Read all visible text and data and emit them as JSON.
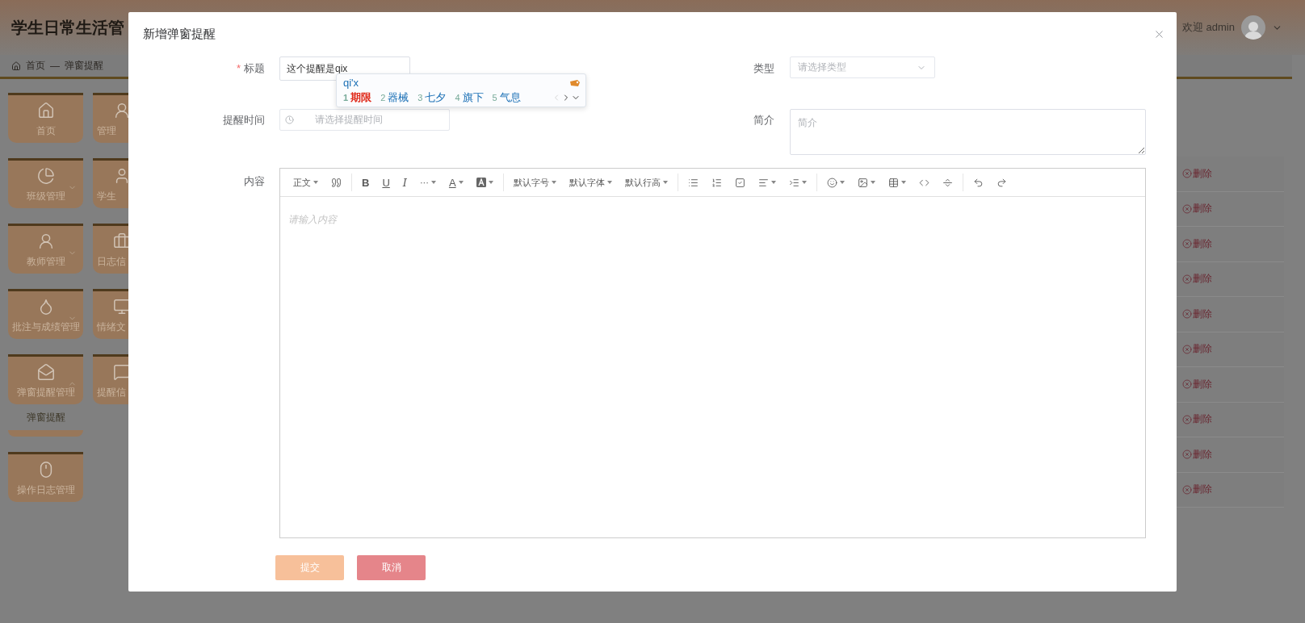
{
  "header": {
    "title": "学生日常生活管",
    "greeting": "欢迎 admin"
  },
  "breadcrumb": {
    "items": [
      "首页",
      "弹窗提醒"
    ],
    "separator": "—"
  },
  "sidebar": {
    "columns": [
      [
        {
          "label": "首页",
          "kind": "link"
        },
        {
          "label": "班级管理",
          "kind": "menu",
          "expanded": false
        },
        {
          "label": "教师管理",
          "kind": "menu",
          "expanded": false
        },
        {
          "label": "批注与成绩管理",
          "kind": "menu",
          "expanded": false
        },
        {
          "label": "弹窗提醒管理",
          "kind": "menu",
          "expanded": true,
          "children": [
            {
              "label": "弹窗提醒"
            }
          ]
        },
        {
          "label": "操作日志管理",
          "kind": "link"
        }
      ],
      [
        {
          "label": "管理",
          "kind": "link"
        },
        {
          "label": "学生",
          "kind": "link"
        },
        {
          "label": "日志信",
          "kind": "link"
        },
        {
          "label": "情绪文",
          "kind": "link"
        },
        {
          "label": "提醒信",
          "kind": "link"
        }
      ]
    ]
  },
  "table": {
    "rows": [
      {
        "action": "删除"
      },
      {
        "action": "删除"
      },
      {
        "action": "删除"
      },
      {
        "action": "删除"
      },
      {
        "action": "删除"
      },
      {
        "action": "删除"
      },
      {
        "action": "删除"
      },
      {
        "action": "删除"
      },
      {
        "action": "删除"
      },
      {
        "action": "删除"
      }
    ]
  },
  "dialog": {
    "title": "新增弹窗提醒",
    "fields": {
      "title": {
        "label": "标题",
        "required_mark": "*",
        "value": "这个提醒是qix"
      },
      "type": {
        "label": "类型",
        "placeholder": "请选择类型"
      },
      "time": {
        "label": "提醒时间",
        "placeholder": "请选择提醒时间"
      },
      "summary": {
        "label": "简介",
        "placeholder": "简介"
      },
      "content": {
        "label": "内容",
        "placeholder": "请输入内容"
      }
    },
    "toolbar": [
      [
        {
          "kind": "text",
          "label": "正文",
          "menu": true
        },
        {
          "kind": "icon",
          "menu": false
        }
      ],
      [
        {
          "kind": "bold",
          "label": "B",
          "menu": false
        },
        {
          "kind": "underline",
          "label": "U",
          "menu": false
        },
        {
          "kind": "italic",
          "label": "I",
          "menu": false
        },
        {
          "kind": "text",
          "label": "···",
          "menu": true
        },
        {
          "kind": "underline",
          "label": "A",
          "menu": true
        },
        {
          "kind": "icon",
          "menu": true
        }
      ],
      [
        {
          "kind": "text",
          "label": "默认字号",
          "menu": true
        },
        {
          "kind": "text",
          "label": "默认字体",
          "menu": true
        },
        {
          "kind": "text",
          "label": "默认行高",
          "menu": true
        }
      ],
      [
        {
          "kind": "icon",
          "menu": false
        },
        {
          "kind": "icon",
          "menu": false
        },
        {
          "kind": "icon",
          "menu": false
        },
        {
          "kind": "icon",
          "menu": true
        },
        {
          "kind": "icon",
          "menu": true
        }
      ],
      [
        {
          "kind": "icon",
          "menu": true
        },
        {
          "kind": "icon",
          "menu": true
        },
        {
          "kind": "icon",
          "menu": true
        },
        {
          "kind": "icon",
          "menu": false
        },
        {
          "kind": "icon",
          "menu": false
        }
      ],
      [
        {
          "kind": "icon",
          "menu": false
        },
        {
          "kind": "icon",
          "menu": false
        }
      ]
    ],
    "buttons": [
      {
        "label": "提交",
        "kind": "primary"
      },
      {
        "label": "取消",
        "kind": "danger"
      }
    ]
  },
  "ime": {
    "composition": "qi'x",
    "prev_enabled": false,
    "candidates": [
      {
        "index": "1",
        "word": "期限",
        "selected": true
      },
      {
        "index": "2",
        "word": "器械",
        "selected": false
      },
      {
        "index": "3",
        "word": "七夕",
        "selected": false
      },
      {
        "index": "4",
        "word": "旗下",
        "selected": false
      },
      {
        "index": "5",
        "word": "气息",
        "selected": false
      }
    ]
  }
}
